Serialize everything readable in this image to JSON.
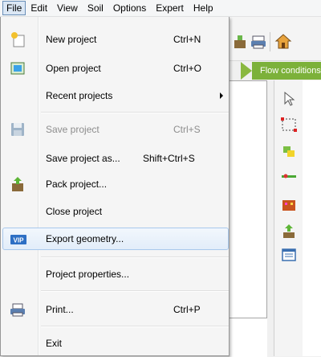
{
  "menubar": {
    "items": [
      "File",
      "Edit",
      "View",
      "Soil",
      "Options",
      "Expert",
      "Help"
    ]
  },
  "file_menu": {
    "new_project": {
      "label": "New project",
      "shortcut": "Ctrl+N"
    },
    "open_project": {
      "label": "Open project",
      "shortcut": "Ctrl+O"
    },
    "recent_projects": {
      "label": "Recent projects"
    },
    "save_project": {
      "label": "Save project",
      "shortcut": "Ctrl+S",
      "enabled": false
    },
    "save_project_as": {
      "label": "Save project as...",
      "shortcut": "Shift+Ctrl+S"
    },
    "pack_project": {
      "label": "Pack project..."
    },
    "close_project": {
      "label": "Close project"
    },
    "export_geometry": {
      "label": "Export geometry...",
      "highlighted": true
    },
    "project_properties": {
      "label": "Project properties..."
    },
    "print": {
      "label": "Print...",
      "shortcut": "Ctrl+P"
    },
    "exit": {
      "label": "Exit"
    }
  },
  "phase_bar": {
    "flow_tab": "Flow conditions"
  },
  "colors": {
    "menu_bg": "#f5f5f5",
    "highlight_border": "#a8c8ec",
    "flow_tab_green": "#7cb13a",
    "disabled_text": "#8d8d8d"
  }
}
